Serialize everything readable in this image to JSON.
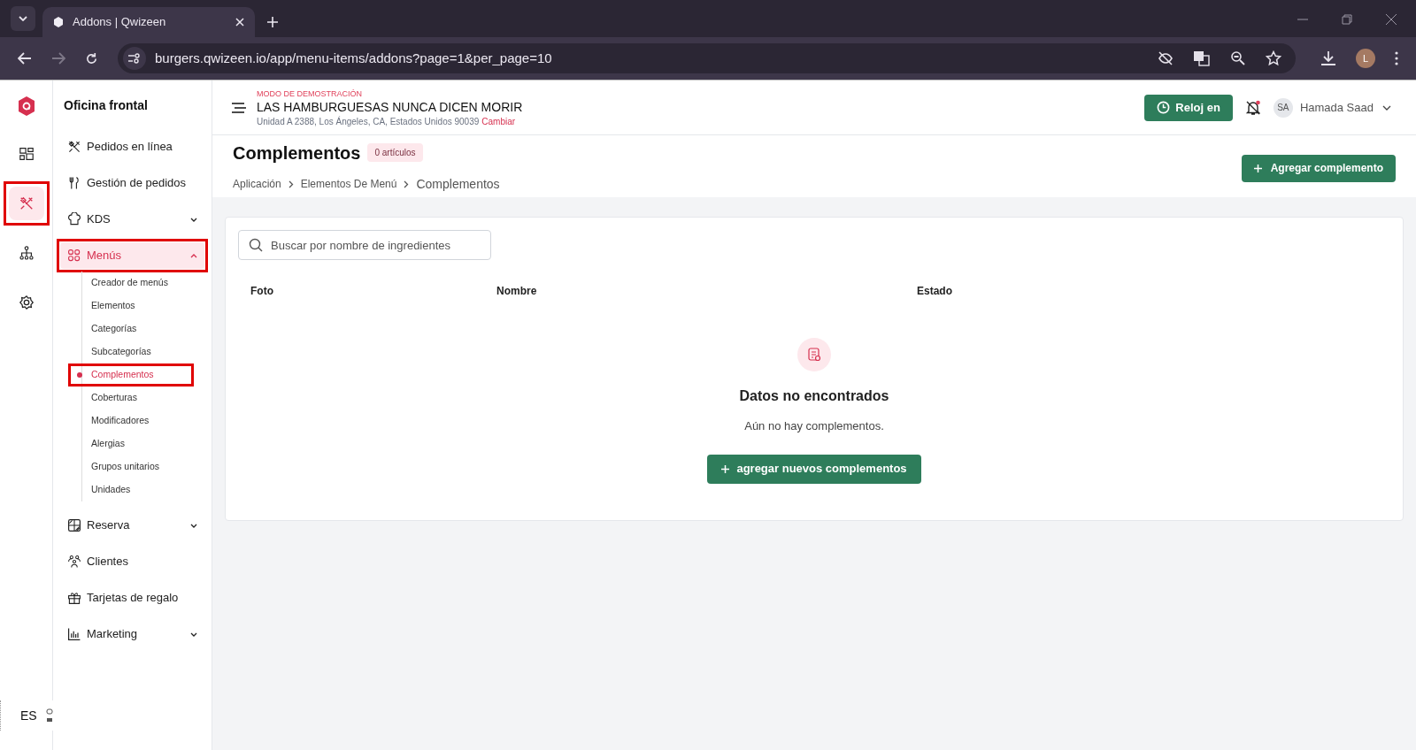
{
  "browser": {
    "tab_title": "Addons | Qwizeen",
    "url": "burgers.qwizeen.io/app/menu-items/addons?page=1&per_page=10",
    "profile_initial": "L"
  },
  "rail": {
    "items": [
      {
        "kind": "dashboard",
        "selected": false,
        "annotated": false
      },
      {
        "kind": "dining",
        "selected": true,
        "annotated": true
      },
      {
        "kind": "hierarchy",
        "selected": false,
        "annotated": false
      },
      {
        "kind": "settings",
        "selected": false,
        "annotated": false
      }
    ],
    "language": "ES"
  },
  "sidebar": {
    "title": "Oficina frontal",
    "items": [
      {
        "label": "Pedidos en línea",
        "kind": "dining",
        "selected": false,
        "annotated": false
      },
      {
        "label": "Gestión de pedidos",
        "kind": "utensils",
        "selected": false,
        "annotated": false
      },
      {
        "label": "KDS",
        "kind": "chef",
        "selected": false,
        "annotated": false,
        "expanded": false
      },
      {
        "label": "Menús",
        "kind": "grid",
        "selected": true,
        "annotated": true,
        "expanded": true,
        "children": [
          {
            "label": "Creador de menús",
            "selected": false,
            "annotated": false
          },
          {
            "label": "Elementos",
            "selected": false,
            "annotated": false
          },
          {
            "label": "Categorías",
            "selected": false,
            "annotated": false
          },
          {
            "label": "Subcategorías",
            "selected": false,
            "annotated": false
          },
          {
            "label": "Complementos",
            "selected": true,
            "annotated": true
          },
          {
            "label": "Coberturas",
            "selected": false,
            "annotated": false
          },
          {
            "label": "Modificadores",
            "selected": false,
            "annotated": false
          },
          {
            "label": "Alergias",
            "selected": false,
            "annotated": false
          },
          {
            "label": "Grupos unitarios",
            "selected": false,
            "annotated": false
          },
          {
            "label": "Unidades",
            "selected": false,
            "annotated": false
          }
        ]
      },
      {
        "label": "Reserva",
        "kind": "table",
        "selected": false,
        "annotated": false,
        "expanded": false
      },
      {
        "label": "Clientes",
        "kind": "people",
        "selected": false,
        "annotated": false
      },
      {
        "label": "Tarjetas de regalo",
        "kind": "gift",
        "selected": false,
        "annotated": false
      },
      {
        "label": "Marketing",
        "kind": "chart",
        "selected": false,
        "annotated": false,
        "expanded": false
      }
    ]
  },
  "header": {
    "demo_label": "MODO DE DEMOSTRACIÓN",
    "restaurant": "LAS HAMBURGUESAS NUNCA DICEN MORIR",
    "address": "Unidad A 2388, Los Ángeles, CA, Estados Unidos 90039",
    "change_link": "Cambiar",
    "clock_button": "Reloj en",
    "user_initials": "SA",
    "user_name": "Hamada Saad"
  },
  "page": {
    "title": "Complementos",
    "count_badge": "0 artículos",
    "breadcrumbs": [
      "Aplicación",
      "Elementos De Menú",
      "Complementos"
    ],
    "add_button": "Agregar complemento"
  },
  "search": {
    "placeholder": "Buscar por nombre de ingredientes"
  },
  "table": {
    "columns": [
      "Foto",
      "Nombre",
      "Estado"
    ]
  },
  "empty_state": {
    "title": "Datos no encontrados",
    "message": "Aún no hay complementos.",
    "button": "agregar nuevos complementos"
  }
}
